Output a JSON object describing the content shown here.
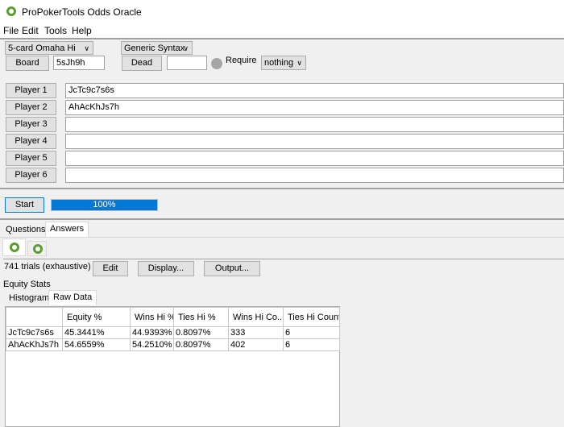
{
  "window": {
    "title": "ProPokerTools Odds Oracle"
  },
  "menu": [
    "File",
    "Edit",
    "Tools",
    "Help"
  ],
  "controls": {
    "game": "5-card Omaha Hi",
    "syntax": "Generic Syntax",
    "board_label": "Board",
    "board_value": "5sJh9h",
    "dead_label": "Dead",
    "dead_value": "",
    "require_label": "Require",
    "require_value": "nothing"
  },
  "players": [
    {
      "label": "Player 1",
      "value": "JcTc9c7s6s"
    },
    {
      "label": "Player 2",
      "value": "AhAcKhJs7h"
    },
    {
      "label": "Player 3",
      "value": ""
    },
    {
      "label": "Player 4",
      "value": ""
    },
    {
      "label": "Player 5",
      "value": ""
    },
    {
      "label": "Player 6",
      "value": ""
    }
  ],
  "run": {
    "start_label": "Start",
    "progress_text": "100%",
    "progress": 100
  },
  "tabs": [
    "Questions",
    "Answers"
  ],
  "answers": {
    "trials": "741 trials (exhaustive)",
    "edit": "Edit",
    "display": "Display...",
    "output": "Output...",
    "section": "Equity Stats",
    "subtabs": [
      "Histogram",
      "Raw Data"
    ]
  },
  "table": {
    "headers": [
      "",
      "Equity %",
      "Wins Hi %",
      "Ties Hi %",
      "Wins Hi Co...",
      "Ties Hi Count"
    ],
    "rows": [
      [
        "JcTc9c7s6s",
        "45.3441%",
        "44.9393%",
        "0.8097%",
        "333",
        "6"
      ],
      [
        "AhAcKhJs7h",
        "54.6559%",
        "54.2510%",
        "0.8097%",
        "402",
        "6"
      ]
    ]
  },
  "colors": {
    "accent": "#0078d7",
    "logo": "#5a9e2f"
  }
}
